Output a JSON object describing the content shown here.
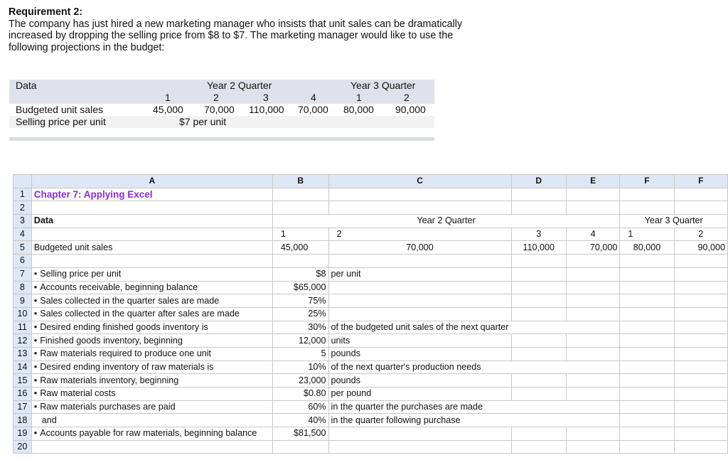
{
  "requirement": {
    "title": "Requirement 2:",
    "lines": [
      "The company has just hired a new marketing manager who insists that unit sales can be dramatically",
      "increased by dropping the selling price from $8 to $7. The marketing manager would like to use the",
      "following projections in the budget:"
    ]
  },
  "projections": {
    "data_label": "Data",
    "year2_label": "Year 2 Quarter",
    "year3_label": "Year 3 Quarter",
    "quarters": [
      "1",
      "2",
      "3",
      "4",
      "1",
      "2"
    ],
    "rows": [
      {
        "label": "Budgeted unit sales",
        "values": [
          "45,000",
          "70,000",
          "110,000",
          "70,000",
          "80,000",
          "90,000"
        ]
      },
      {
        "label": "Selling price per unit",
        "value": "$7 per unit"
      }
    ]
  },
  "sheet": {
    "columns": [
      "",
      "A",
      "B",
      "C",
      "D",
      "E",
      "F",
      "F"
    ],
    "title": "Chapter 7: Applying Excel",
    "data_label": "Data",
    "year2_label": "Year 2 Quarter",
    "year3_label": "Year 3 Quarter",
    "quarters": [
      "1",
      "2",
      "3",
      "4",
      "1",
      "2"
    ],
    "budgeted_unit_sales_label": "Budgeted unit sales",
    "budgeted_unit_sales": [
      "45,000",
      "70,000",
      "110,000",
      "70,000",
      "80,000",
      "90,000"
    ],
    "bullet": "•",
    "items": [
      {
        "row": "7",
        "label": "Selling price per unit",
        "bullet": true,
        "value": "$8",
        "note": "per unit"
      },
      {
        "row": "8",
        "label": "Accounts receivable, beginning balance",
        "bullet": true,
        "value": "$65,000",
        "note": ""
      },
      {
        "row": "9",
        "label": "Sales collected in the quarter sales are made",
        "bullet": true,
        "value": "75%",
        "note": ""
      },
      {
        "row": "10",
        "label": "Sales collected in the quarter after sales are made",
        "bullet": true,
        "value": "25%",
        "note": ""
      },
      {
        "row": "11",
        "label": "Desired ending finished goods inventory is",
        "bullet": true,
        "value": "30%",
        "note": "of the budgeted unit sales of the next quarter"
      },
      {
        "row": "12",
        "label": "Finished goods inventory, beginning",
        "bullet": true,
        "value": "12,000",
        "note": "units"
      },
      {
        "row": "13",
        "label": "Raw materials required to produce one unit",
        "bullet": true,
        "value": "5",
        "note": "pounds"
      },
      {
        "row": "14",
        "label": "Desired ending inventory of raw materials is",
        "bullet": true,
        "value": "10%",
        "note": "of the next quarter's production needs"
      },
      {
        "row": "15",
        "label": "Raw materials inventory, beginning",
        "bullet": true,
        "value": "23,000",
        "note": "pounds"
      },
      {
        "row": "16",
        "label": "Raw material costs",
        "bullet": true,
        "value": "$0.80",
        "note": "per pound"
      },
      {
        "row": "17",
        "label": "Raw materials purchases are paid",
        "bullet": true,
        "value": "60%",
        "note": "in the quarter the purchases are made"
      },
      {
        "row": "18",
        "label": "and",
        "bullet": false,
        "value": "40%",
        "note": "in the quarter following purchase"
      },
      {
        "row": "19",
        "label": "Accounts payable for raw materials, beginning balance",
        "bullet": true,
        "value": "$81,500",
        "note": ""
      }
    ],
    "row_numbers": [
      "1",
      "2",
      "3",
      "4",
      "5",
      "6",
      "7",
      "8",
      "9",
      "10",
      "11",
      "12",
      "13",
      "14",
      "15",
      "16",
      "17",
      "18",
      "19",
      "20"
    ]
  }
}
